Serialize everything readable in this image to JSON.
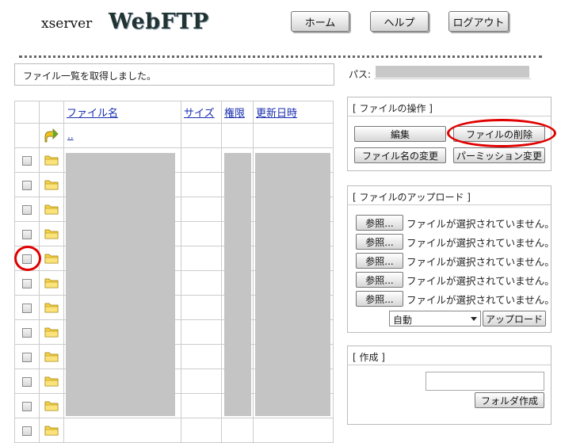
{
  "header": {
    "logo_small": "xserver",
    "logo_big": "WebFTP",
    "buttons": [
      "ホーム",
      "ヘルプ",
      "ログアウト"
    ]
  },
  "status": {
    "message": "ファイル一覧を取得しました。"
  },
  "path": {
    "label": "パス:"
  },
  "file_table": {
    "columns": [
      "ファイル名",
      "サイズ",
      "権限",
      "更新日時"
    ],
    "parent_link": ".."
  },
  "file_ops": {
    "title": "[ ファイルの操作 ]",
    "edit": "編集",
    "delete": "ファイルの削除",
    "rename": "ファイル名の変更",
    "permission": "パーミッション変更"
  },
  "upload": {
    "title": "[ ファイルのアップロード ]",
    "browse_label": "参照...",
    "no_file_text": "ファイルが選択されていません。",
    "mode_selected": "自動",
    "upload_button": "アップロード"
  },
  "create": {
    "title": "[ 作成 ]",
    "folder_button": "フォルダ作成"
  },
  "colors": {
    "link": "#1a2fb0",
    "highlight": "#e00000"
  }
}
